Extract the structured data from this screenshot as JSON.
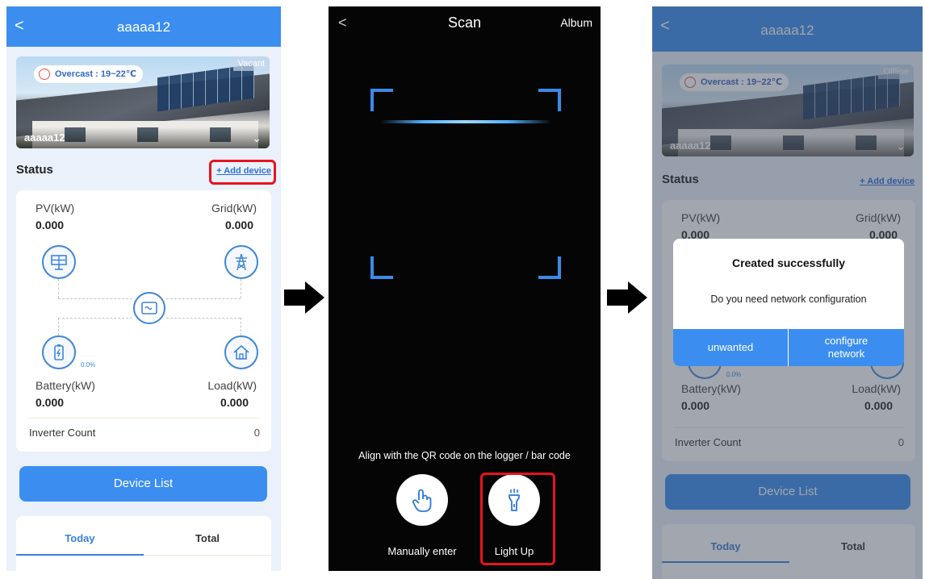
{
  "screen1": {
    "title": "aaaaa12",
    "back": "<",
    "weather": "Overcast : 19~22℃",
    "tag": "Vacant",
    "site_name": "aaaaa12",
    "status_title": "Status",
    "add_device": "+ Add device",
    "pv_label": "PV(kW)",
    "pv_value": "0.000",
    "grid_label": "Grid(kW)",
    "grid_value": "0.000",
    "battery_label": "Battery(kW)",
    "battery_value": "0.000",
    "battery_pct": "0.0%",
    "load_label": "Load(kW)",
    "load_value": "0.000",
    "inverter_count_label": "Inverter Count",
    "inverter_count": "0",
    "device_list": "Device List",
    "tab_today": "Today",
    "tab_total": "Total"
  },
  "screen2": {
    "back": "<",
    "title": "Scan",
    "album": "Album",
    "hint": "Align with the QR code on the logger / bar code",
    "manual_label": "Manually enter",
    "light_label": "Light Up"
  },
  "screen3": {
    "title": "aaaaa12",
    "back": "<",
    "weather": "Overcast : 19~22℃",
    "tag": "Offline",
    "site_name": "aaaaa12",
    "status_title": "Status",
    "add_device": "+ Add device",
    "pv_label": "PV(kW)",
    "pv_value": "0.000",
    "grid_label": "Grid(kW)",
    "grid_value": "0.000",
    "battery_label": "Battery(kW)",
    "battery_value": "0.000",
    "battery_pct": "0.0%",
    "load_label": "Load(kW)",
    "load_value": "0.000",
    "inverter_count_label": "Inverter Count",
    "inverter_count": "0",
    "device_list": "Device List",
    "tab_today": "Today",
    "tab_total": "Total",
    "dialog": {
      "title": "Created successfully",
      "message": "Do you need network configuration",
      "button_unwanted": "unwanted",
      "button_configure_line1": "configure",
      "button_configure_line2": "network"
    }
  },
  "colors": {
    "brand": "#3b8ef0",
    "highlight": "#e6141e",
    "scan_corner": "#3a8be8"
  },
  "icons": [
    "back-icon",
    "cloud-icon",
    "chevron-down-icon",
    "solar-panel-icon",
    "grid-tower-icon",
    "inverter-icon",
    "battery-icon",
    "home-icon",
    "hand-pointer-icon",
    "flashlight-icon",
    "arrow-right-icon"
  ]
}
